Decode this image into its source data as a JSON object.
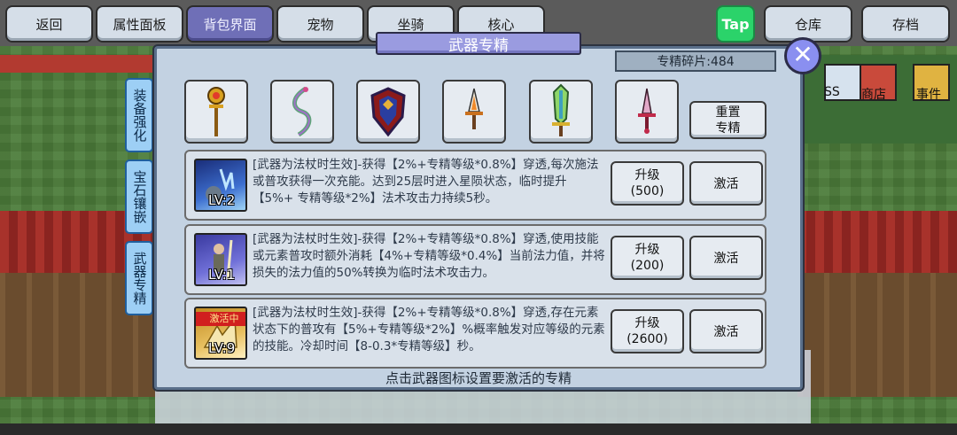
{
  "nav": {
    "back": "返回",
    "attributes": "属性面板",
    "backpack": "背包界面",
    "pet": "宠物",
    "mount": "坐骑",
    "core": "核心",
    "tap": "Tap",
    "warehouse": "仓库",
    "save": "存档"
  },
  "side_tabs": [
    {
      "label": "装备强化"
    },
    {
      "label": "宝石镶嵌"
    },
    {
      "label": "武器专精"
    }
  ],
  "modal": {
    "title": "武器专精",
    "shards": "专精碎片:484",
    "reset_line1": "重置",
    "reset_line2": "专精",
    "hint": "点击武器图标设置要激活的专精"
  },
  "weapons": [
    {
      "icon": "golden-staff-icon"
    },
    {
      "icon": "serpent-bow-icon"
    },
    {
      "icon": "ornate-shield-icon"
    },
    {
      "icon": "flame-dagger-icon"
    },
    {
      "icon": "jade-sword-icon"
    },
    {
      "icon": "ruby-dagger-icon"
    }
  ],
  "specialties": [
    {
      "level": "LV:2",
      "desc": "[武器为法杖时生效]-获得【2%+专精等级*0.8%】穿透,每次施法或普攻获得一次充能。达到25层时进入星陨状态，临时提升【5%+ 专精等级*2%】法术攻击力持续5秒。",
      "upgrade_label": "升级",
      "upgrade_cost": "(500)",
      "activate": "激活",
      "active_badge": ""
    },
    {
      "level": "LV:1",
      "desc": "[武器为法杖时生效]-获得【2%+专精等级*0.8%】穿透,使用技能或元素普攻时额外消耗【4%+专精等级*0.4%】当前法力值，并将损失的法力值的50%转换为临时法术攻击力。",
      "upgrade_label": "升级",
      "upgrade_cost": "(200)",
      "activate": "激活",
      "active_badge": ""
    },
    {
      "level": "LV:9",
      "desc": "[武器为法杖时生效]-获得【2%+专精等级*0.8%】穿透,存在元素状态下的普攻有【5%+专精等级*2%】%概率触发对应等级的元素的技能。冷却时间【8-0.3*专精等级】秒。",
      "upgrade_label": "升级",
      "upgrade_cost": "(2600)",
      "activate": "激活",
      "active_badge": "激活中"
    }
  ],
  "background": {
    "shop_labels": [
      "SS",
      "商店",
      "事件"
    ]
  }
}
